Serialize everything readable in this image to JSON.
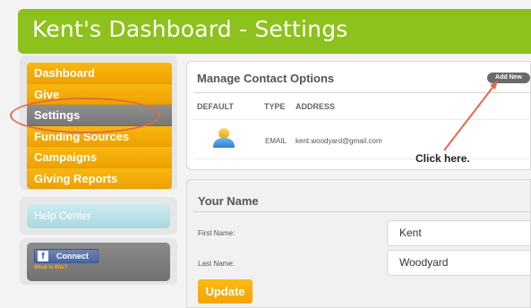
{
  "header": {
    "title": "Kent's Dashboard - Settings"
  },
  "sidebar": {
    "items": [
      {
        "label": "Dashboard"
      },
      {
        "label": "Give"
      },
      {
        "label": "Settings",
        "active": true
      },
      {
        "label": "Funding Sources"
      },
      {
        "label": "Campaigns"
      },
      {
        "label": "Giving Reports"
      }
    ],
    "help_label": "Help Center",
    "connect_label": "Connect",
    "whatis_label": "What is this?"
  },
  "contacts": {
    "title": "Manage Contact Options",
    "add_new_label": "Add New",
    "columns": [
      "DEFAULT",
      "TYPE",
      "ADDRESS"
    ],
    "rows": [
      {
        "type": "EMAIL",
        "address": "kent.woodyard@gmail.com"
      }
    ],
    "annotation": "Click here."
  },
  "name_form": {
    "title": "Your Name",
    "first_label": "First Name:",
    "first_value": "Kent",
    "last_label": "Last Name:",
    "last_value": "Woodyard",
    "update_label": "Update"
  },
  "colors": {
    "header_green": "#8cc21b",
    "nav_orange": "#f5ad06",
    "nav_active_gray": "#808080",
    "annotation_red": "#e06a4c",
    "help_blue": "#b9e1e8"
  }
}
